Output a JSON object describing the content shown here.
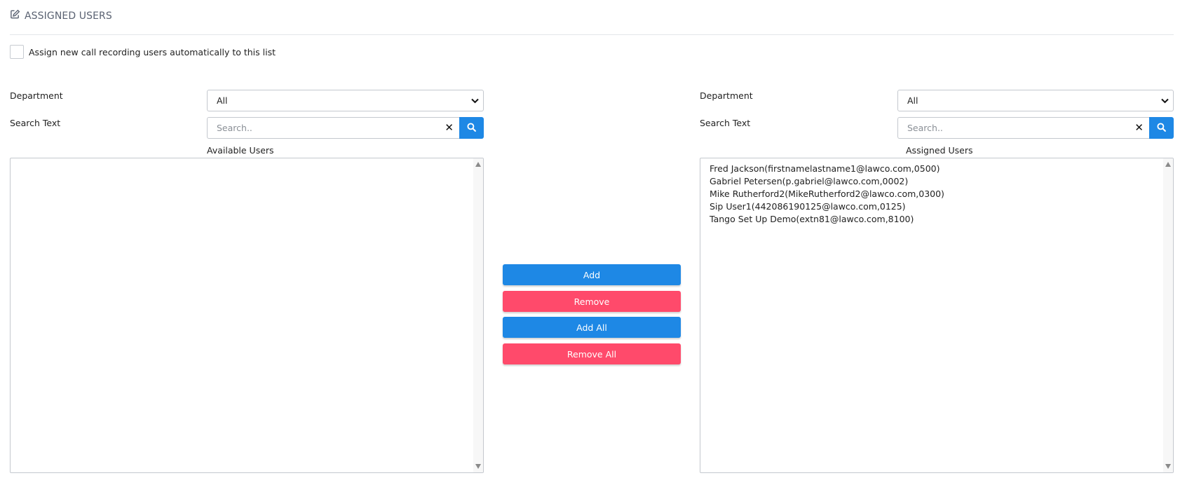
{
  "header": {
    "title": "ASSIGNED USERS",
    "icon": "edit-icon"
  },
  "auto_assign": {
    "label": "Assign new call recording users automatically to this list",
    "checked": false
  },
  "left": {
    "department_label": "Department",
    "department_value": "All",
    "search_label": "Search Text",
    "search_placeholder": "Search..",
    "list_title": "Available Users",
    "items": []
  },
  "right": {
    "department_label": "Department",
    "department_value": "All",
    "search_label": "Search Text",
    "search_placeholder": "Search..",
    "list_title": "Assigned Users",
    "items": [
      "Fred Jackson(firstnamelastname1@lawco.com,0500)",
      "Gabriel Petersen(p.gabriel@lawco.com,0002)",
      "Mike Rutherford2(MikeRutherford2@lawco.com,0300)",
      "Sip User1(442086190125@lawco.com,0125)",
      "Tango Set Up Demo(extn81@lawco.com,8100)"
    ]
  },
  "actions": {
    "add": "Add",
    "remove": "Remove",
    "add_all": "Add All",
    "remove_all": "Remove All"
  },
  "colors": {
    "primary": "#1e88e5",
    "danger": "#ff4a6b",
    "header_text": "#5a6272"
  }
}
